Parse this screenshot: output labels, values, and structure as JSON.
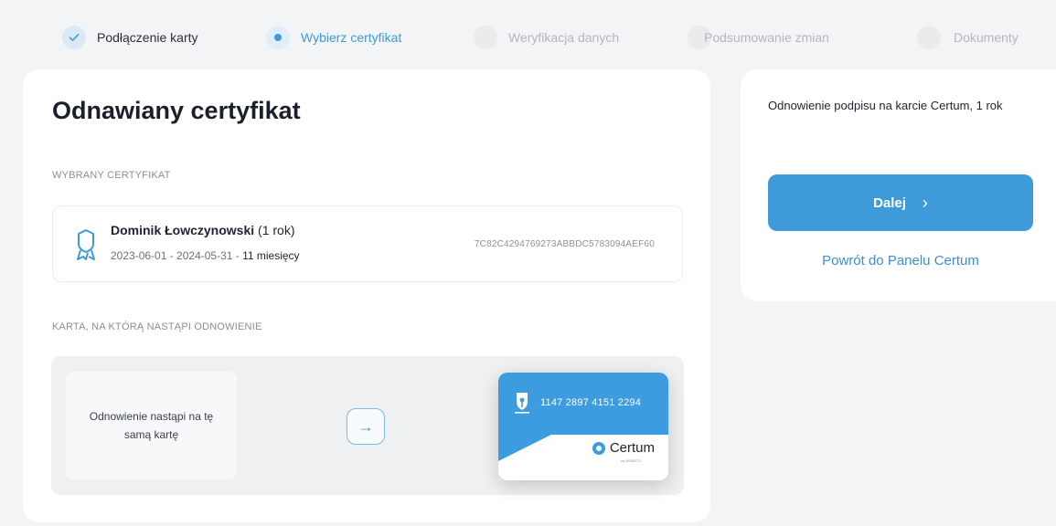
{
  "stepper": {
    "steps": [
      {
        "label": "Podłączenie karty",
        "state": "done"
      },
      {
        "label": "Wybierz certyfikat",
        "state": "active"
      },
      {
        "label": "Weryfikacja danych",
        "state": "pending"
      },
      {
        "label": "Podsumowanie zmian",
        "state": "pending"
      },
      {
        "label": "Dokumenty",
        "state": "pending"
      }
    ]
  },
  "main": {
    "title": "Odnawiany certyfikat",
    "selected_label": "WYBRANY CERTYFIKAT",
    "certificate": {
      "name": "Dominik Łowczynowski",
      "duration": "(1 rok)",
      "dates": "2023-06-01 - 2024-05-31 - ",
      "months": "11 miesięcy",
      "hash": "7C82C4294769273ABBDC5783094AEF60",
      "icon": "certificate-badge-icon"
    },
    "card_label": "KARTA, NA KTÓRĄ NASTĄPI ODNOWIENIE",
    "same_card_text": "Odnowienie nastąpi na tę samą kartę",
    "arrow": "→",
    "card": {
      "number": "1147 2897 4151 2294",
      "brand": "Certum",
      "brand_sub": "by ASSECO"
    }
  },
  "side": {
    "title": "Odnowienie podpisu na karcie Certum, 1 rok",
    "next_label": "Dalej",
    "next_chevron": "›",
    "back_label": "Powrót do Panelu Certum"
  },
  "colors": {
    "accent": "#3f9ad9",
    "background": "#f3f4f6",
    "card": "#ffffff"
  }
}
